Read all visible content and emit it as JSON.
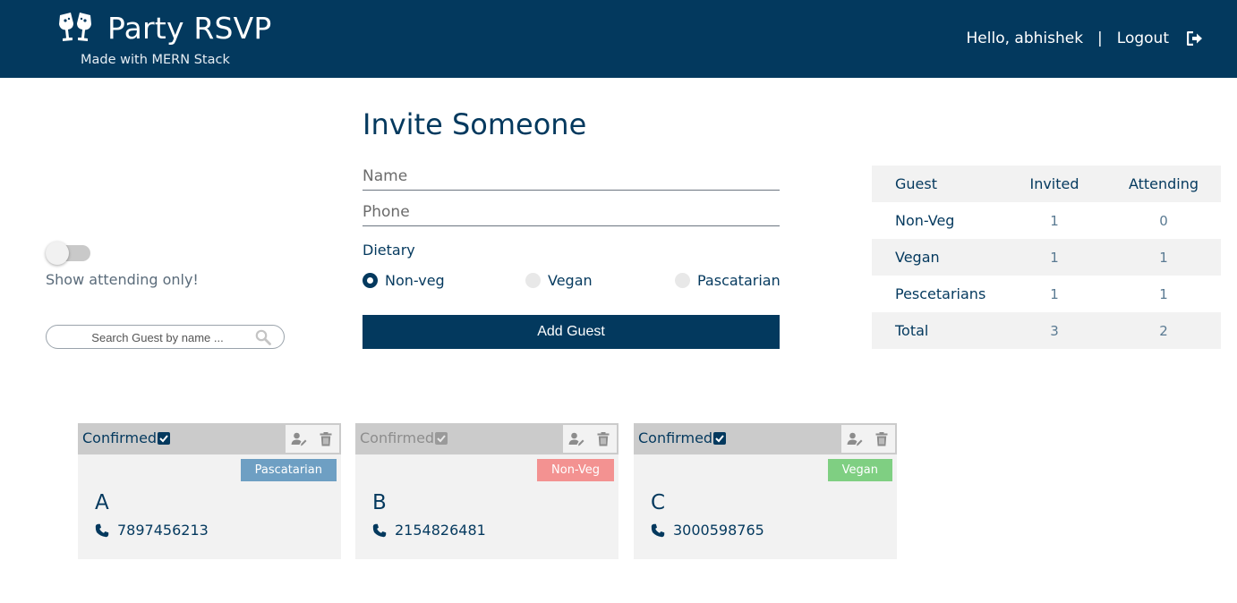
{
  "header": {
    "title": "Party RSVP",
    "subtitle": "Made with MERN Stack",
    "greeting": "Hello, abhishek",
    "separator": "|",
    "logout_label": "Logout",
    "background": "#03395e"
  },
  "filter": {
    "toggle_label": "Show attending only!",
    "toggle_on": false,
    "search_placeholder": "Search Guest by name ..."
  },
  "form": {
    "title": "Invite Someone",
    "name_placeholder": "Name",
    "phone_placeholder": "Phone",
    "dietary_label": "Dietary",
    "options": [
      "Non-veg",
      "Vegan",
      "Pascatarian"
    ],
    "selected_option": "Non-veg",
    "submit_label": "Add Guest"
  },
  "stats": {
    "headers": [
      "Guest",
      "Invited",
      "Attending"
    ],
    "rows": [
      {
        "label": "Non-Veg",
        "invited": "1",
        "attending": "0"
      },
      {
        "label": "Vegan",
        "invited": "1",
        "attending": "1"
      },
      {
        "label": "Pescetarians",
        "invited": "1",
        "attending": "1"
      },
      {
        "label": "Total",
        "invited": "3",
        "attending": "2"
      }
    ]
  },
  "guests": [
    {
      "confirm_label": "Confirmed",
      "confirmed": true,
      "diet": "Pascatarian",
      "diet_color": "#6e9fc3",
      "name": "A",
      "phone": "7897456213"
    },
    {
      "confirm_label": "Confirmed",
      "confirmed": false,
      "diet": "Non-Veg",
      "diet_color": "#f39291",
      "name": "B",
      "phone": "2154826481"
    },
    {
      "confirm_label": "Confirmed",
      "confirmed": true,
      "diet": "Vegan",
      "diet_color": "#7fcf82",
      "name": "C",
      "phone": "3000598765"
    }
  ]
}
